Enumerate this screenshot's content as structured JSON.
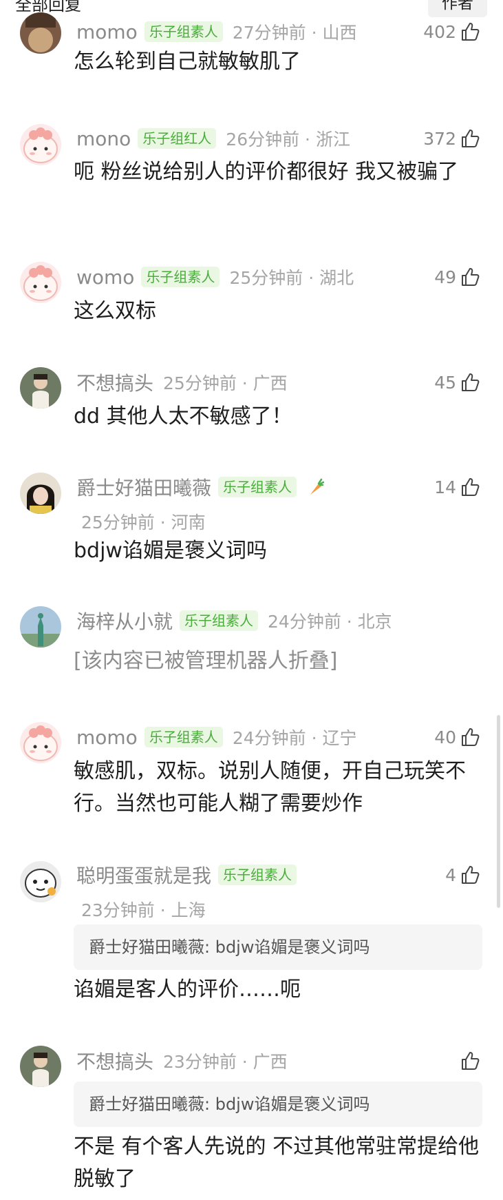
{
  "header": {
    "title": "全部回复",
    "author_tab": "作者"
  },
  "comments": [
    {
      "name": "momo",
      "badge": "乐子组素人",
      "time": "27分钟前",
      "loc": "山西",
      "likes": "402",
      "text": "怎么轮到自己就敏敏肌了"
    },
    {
      "name": "mono",
      "badge": "乐子组红人",
      "time": "26分钟前",
      "loc": "浙江",
      "likes": "372",
      "text": "呃 粉丝说给别人的评价都很好 我又被骗了"
    },
    {
      "name": "womo",
      "badge": "乐子组素人",
      "time": "25分钟前",
      "loc": "湖北",
      "likes": "49",
      "text": "这么双标"
    },
    {
      "name": "不想搞头",
      "time": "25分钟前",
      "loc": "广西",
      "likes": "45",
      "text": "dd 其他人太不敏感了！"
    },
    {
      "name": "爵士好猫田曦薇",
      "badge": "乐子组素人",
      "time": "25分钟前",
      "loc": "河南",
      "likes": "14",
      "text": "bdjw谄媚是褒义词吗"
    },
    {
      "name": "海梓从小就",
      "badge": "乐子组素人",
      "time": "24分钟前",
      "loc": "北京",
      "text": "[该内容已被管理机器人折叠]"
    },
    {
      "name": "momo",
      "badge": "乐子组素人",
      "time": "24分钟前",
      "loc": "辽宁",
      "likes": "40",
      "text": "敏感肌，双标。说别人随便，开自己玩笑不行。当然也可能人糊了需要炒作"
    },
    {
      "name": "聪明蛋蛋就是我",
      "badge": "乐子组素人",
      "time": "23分钟前",
      "loc": "上海",
      "likes": "4",
      "quote": "爵士好猫田曦薇: bdjw谄媚是褒义词吗",
      "text": "谄媚是客人的评价……呃"
    },
    {
      "name": "不想搞头",
      "time": "23分钟前",
      "loc": "广西",
      "quote": "爵士好猫田曦薇: bdjw谄媚是褒义词吗",
      "text": "不是 有个客人先说的 不过其他常驻常提给他脱敏了"
    }
  ],
  "sep": " · ",
  "icons": {
    "like": "thumbs-up-icon",
    "carrot": "carrot-icon"
  },
  "colors": {
    "badge_bg": "#e9f7e3",
    "badge_text": "#4aad3b",
    "meta": "#a5a5a5",
    "folded": "#8d8d8d"
  }
}
